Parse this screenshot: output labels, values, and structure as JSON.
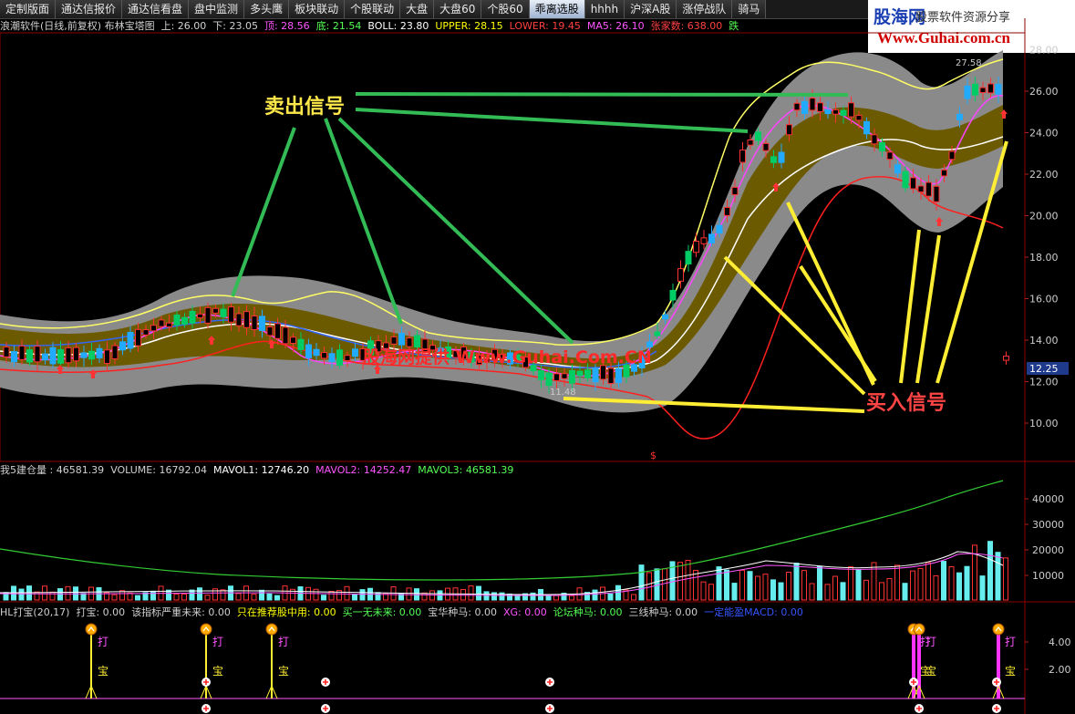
{
  "tabs": [
    "定制版面",
    "通达信报价",
    "通达信看盘",
    "盘中监测",
    "多头鹰",
    "板块联动",
    "个股联动",
    "大盘",
    "大盘60",
    "个股60",
    "乖离选股",
    "hhhh",
    "沪深A股",
    "涨停战队",
    "骑马"
  ],
  "active_tab_index": 10,
  "logo": {
    "brand": "股海网",
    "slogan": "股票软件资源分享",
    "url": "Www.Guhai.com.cn"
  },
  "main_header": [
    {
      "text": "浪潮软件(日线,前复权) 布林宝塔图",
      "color": "#d0d0d0"
    },
    {
      "text": "上: 26.00",
      "color": "#d0d0d0"
    },
    {
      "text": "下: 23.05",
      "color": "#d0d0d0"
    },
    {
      "text": "顶: 28.56",
      "color": "#ff55ff"
    },
    {
      "text": "底: 21.54",
      "color": "#55ff55"
    },
    {
      "text": "BOLL: 23.80",
      "color": "#ffffff"
    },
    {
      "text": "UPPER: 28.15",
      "color": "#ffff00"
    },
    {
      "text": "LOWER: 19.45",
      "color": "#ff4040"
    },
    {
      "text": "MA5: 26.10",
      "color": "#ff55ff"
    },
    {
      "text": "张家数: 638.00",
      "color": "#ff4040"
    },
    {
      "text": "跌",
      "color": "#55ff55"
    }
  ],
  "price_axis": [
    "26.00",
    "24.00",
    "22.00",
    "20.00",
    "18.00",
    "16.00",
    "14.00",
    "12.00",
    "10.00"
  ],
  "price_axis_top": "28.00",
  "current_price": "12.25",
  "peak_label": "27.58",
  "low_label": "11.48",
  "annotations": {
    "sell": "卖出信号",
    "buy": "买入信号",
    "watermark": "股海网提供 Www.Guhai.Com.CN",
    "marker": "$"
  },
  "volume_header": [
    {
      "text": "我5建仓量 : 46581.39",
      "color": "#d0d0d0"
    },
    {
      "text": "VOLUME: 16792.04",
      "color": "#d0d0d0"
    },
    {
      "text": "MAVOL1: 12746.20",
      "color": "#ffffff"
    },
    {
      "text": "MAVOL2: 14252.47",
      "color": "#ff55ff"
    },
    {
      "text": "MAVOL3: 46581.39",
      "color": "#55ff55"
    }
  ],
  "volume_axis": [
    "40000",
    "30000",
    "20000",
    "10000"
  ],
  "signal_header": [
    {
      "text": "HL打宝(20,17)",
      "color": "#d0d0d0"
    },
    {
      "text": "打宝: 0.00",
      "color": "#d0d0d0"
    },
    {
      "text": "该指标严重未来: 0.00",
      "color": "#d0d0d0"
    },
    {
      "text": "只在推荐股中用: 0.00",
      "color": "#ffff00"
    },
    {
      "text": "买一无未来: 0.00",
      "color": "#55ff55"
    },
    {
      "text": "宝华种马: 0.00",
      "color": "#d0d0d0"
    },
    {
      "text": "XG: 0.00",
      "color": "#ff55ff"
    },
    {
      "text": "论坛种马: 0.00",
      "color": "#55ff55"
    },
    {
      "text": "三线种马: 0.00",
      "color": "#d0d0d0"
    },
    {
      "text": "一定能盈MACD: 0.00",
      "color": "#3355ff"
    }
  ],
  "signal_axis": [
    "4.00",
    "2.00"
  ],
  "signal_labels": {
    "a": "打",
    "b": "宝"
  }
}
